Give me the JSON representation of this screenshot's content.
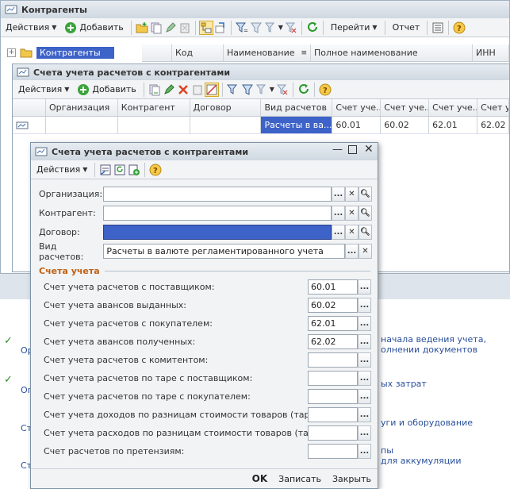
{
  "back_window": {
    "title": "Контрагенты",
    "toolbar": {
      "actions_label": "Действия",
      "add_label": "Добавить",
      "goto_label": "Перейти",
      "report_label": "Отчет"
    },
    "tree_root": "Контрагенты",
    "columns": [
      "Код",
      "Наименование",
      "Полное наименование",
      "ИНН"
    ]
  },
  "list_window": {
    "title": "Счета учета расчетов с контрагентами",
    "toolbar": {
      "actions_label": "Действия",
      "add_label": "Добавить"
    },
    "columns": [
      "Организация",
      "Контрагент",
      "Договор",
      "Вид расчетов",
      "Счет уче...",
      "Счет уче...",
      "Счет уче...",
      "Счет уче..."
    ],
    "row": {
      "organization": "",
      "counterparty": "",
      "contract": "",
      "settlement_type": "Расчеты в ва...",
      "acc1": "60.01",
      "acc2": "60.02",
      "acc3": "62.01",
      "acc4": "62.02"
    }
  },
  "dialog": {
    "title": "Счета учета расчетов с контрагентами",
    "toolbar": {
      "actions_label": "Действия"
    },
    "fields": {
      "organization": {
        "label": "Организация:",
        "value": ""
      },
      "counterparty": {
        "label": "Контрагент:",
        "value": ""
      },
      "contract": {
        "label": "Договор:",
        "value": ""
      },
      "settlement_type": {
        "label": "Вид расчетов:",
        "value": "Расчеты в валюте регламентированного учета"
      }
    },
    "section_title": "Счета учета",
    "accounts": [
      {
        "label": "Счет учета расчетов с поставщиком:",
        "value": "60.01"
      },
      {
        "label": "Счет учета авансов выданных:",
        "value": "60.02"
      },
      {
        "label": "Счет учета расчетов с покупателем:",
        "value": "62.01"
      },
      {
        "label": "Счет учета авансов полученных:",
        "value": "62.02"
      },
      {
        "label": "Счет учета расчетов с комитентом:",
        "value": ""
      },
      {
        "label": "Счет учета расчетов по таре с поставщиком:",
        "value": ""
      },
      {
        "label": "Счет учета расчетов по таре с покупателем:",
        "value": ""
      },
      {
        "label": "Счет учета доходов по разницам стоимости товаров (тары):",
        "value": ""
      },
      {
        "label": "Счет учета расходов по разницам стоимости товаров (тары):",
        "value": ""
      },
      {
        "label": "Счет расчетов по претензиям:",
        "value": ""
      }
    ],
    "buttons": {
      "ok": "OK",
      "save": "Записать",
      "close": "Закрыть"
    }
  },
  "background_panel": {
    "links": [
      "начала ведения учета,",
      "олнении документов",
      "ых затрат",
      "уги и оборудование",
      "пы",
      "для аккумуляции"
    ],
    "left_fragments": [
      "Ор",
      "Оп",
      "Ст",
      "Ст"
    ]
  },
  "colors": {
    "accent_orange": "#c06010",
    "selection_blue": "#3d62c8",
    "title_grad_top": "#e7ecf1"
  }
}
